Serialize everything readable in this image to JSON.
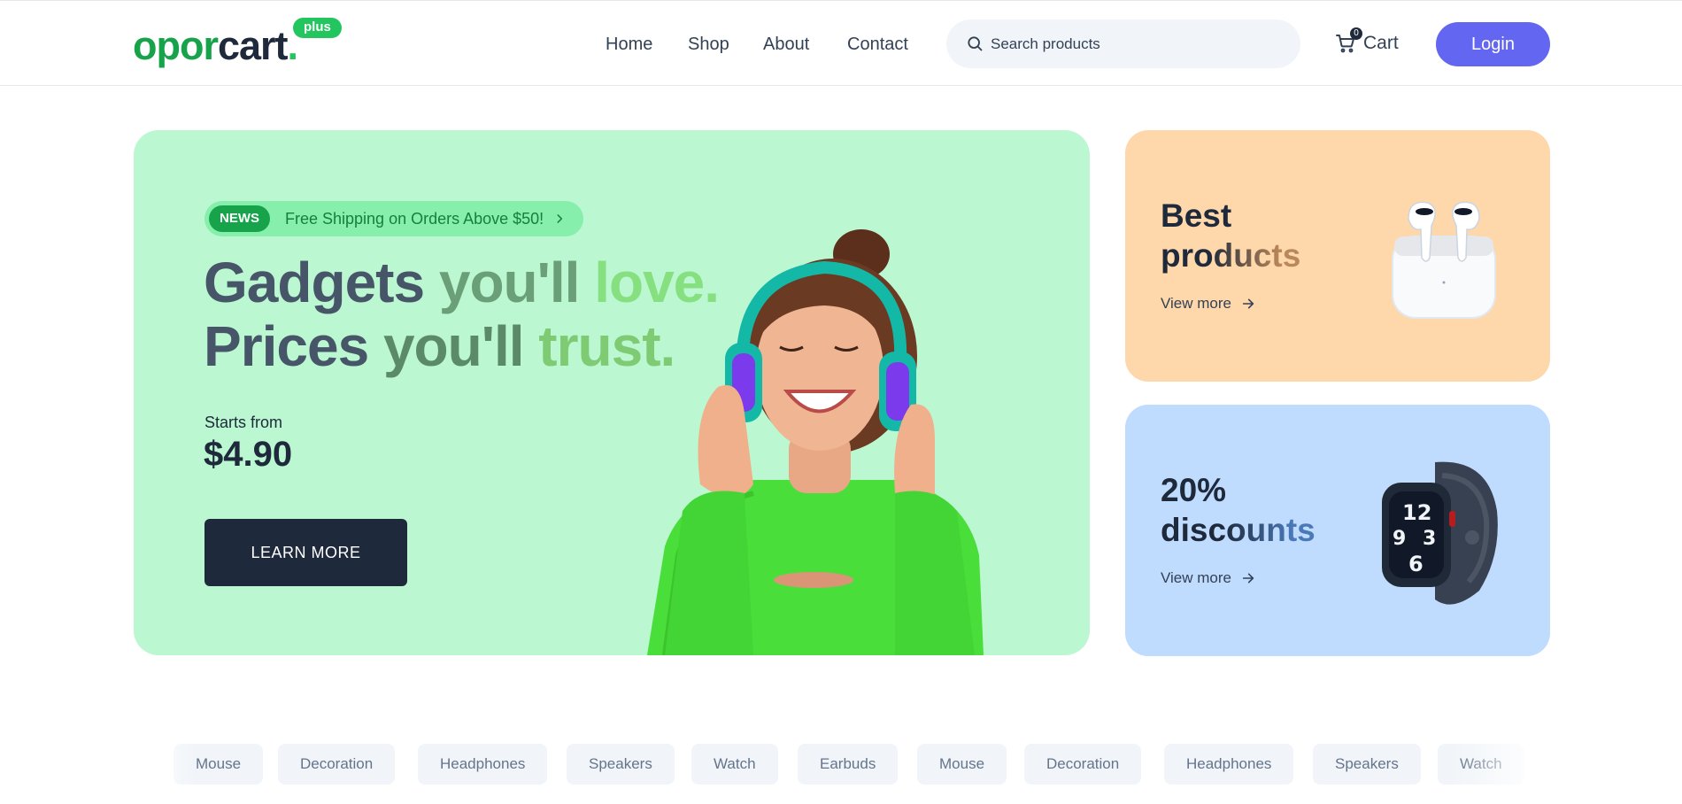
{
  "brand": {
    "name_part1": "opor",
    "name_part2": "cart",
    "dot": ".",
    "badge": "plus"
  },
  "nav": {
    "items": [
      "Home",
      "Shop",
      "About",
      "Contact"
    ]
  },
  "search": {
    "placeholder": "Search products"
  },
  "cart": {
    "label": "Cart",
    "count": "0"
  },
  "login": {
    "label": "Login"
  },
  "hero": {
    "news_tag": "NEWS",
    "news_text": "Free Shipping on Orders Above $50!",
    "line1": [
      "Gadgets ",
      "you'll ",
      "love."
    ],
    "line2": [
      "Prices ",
      "you'll ",
      "trust."
    ],
    "starts_label": "Starts from",
    "price": "$4.90",
    "cta": "LEARN MORE",
    "bg_color": "#bbf7d0"
  },
  "promos": [
    {
      "title_line1": "Best",
      "title_line2": "products",
      "link": "View more",
      "bg_color": "#fed7aa"
    },
    {
      "title_line1": "20%",
      "title_line2": "discounts",
      "link": "View more",
      "bg_color": "#bfdbfe"
    }
  ],
  "categories": [
    "Mouse",
    "Decoration",
    "Headphones",
    "Speakers",
    "Watch",
    "Earbuds",
    "Mouse",
    "Decoration",
    "Headphones",
    "Speakers",
    "Watch"
  ],
  "colors": {
    "primary": "#6366f1",
    "brand_green": "#16a34a",
    "dark": "#1e293b"
  },
  "icons": {
    "search": "search-icon",
    "cart": "cart-icon",
    "arrow": "arrow-right-icon",
    "chevron": "chevron-right-icon"
  }
}
